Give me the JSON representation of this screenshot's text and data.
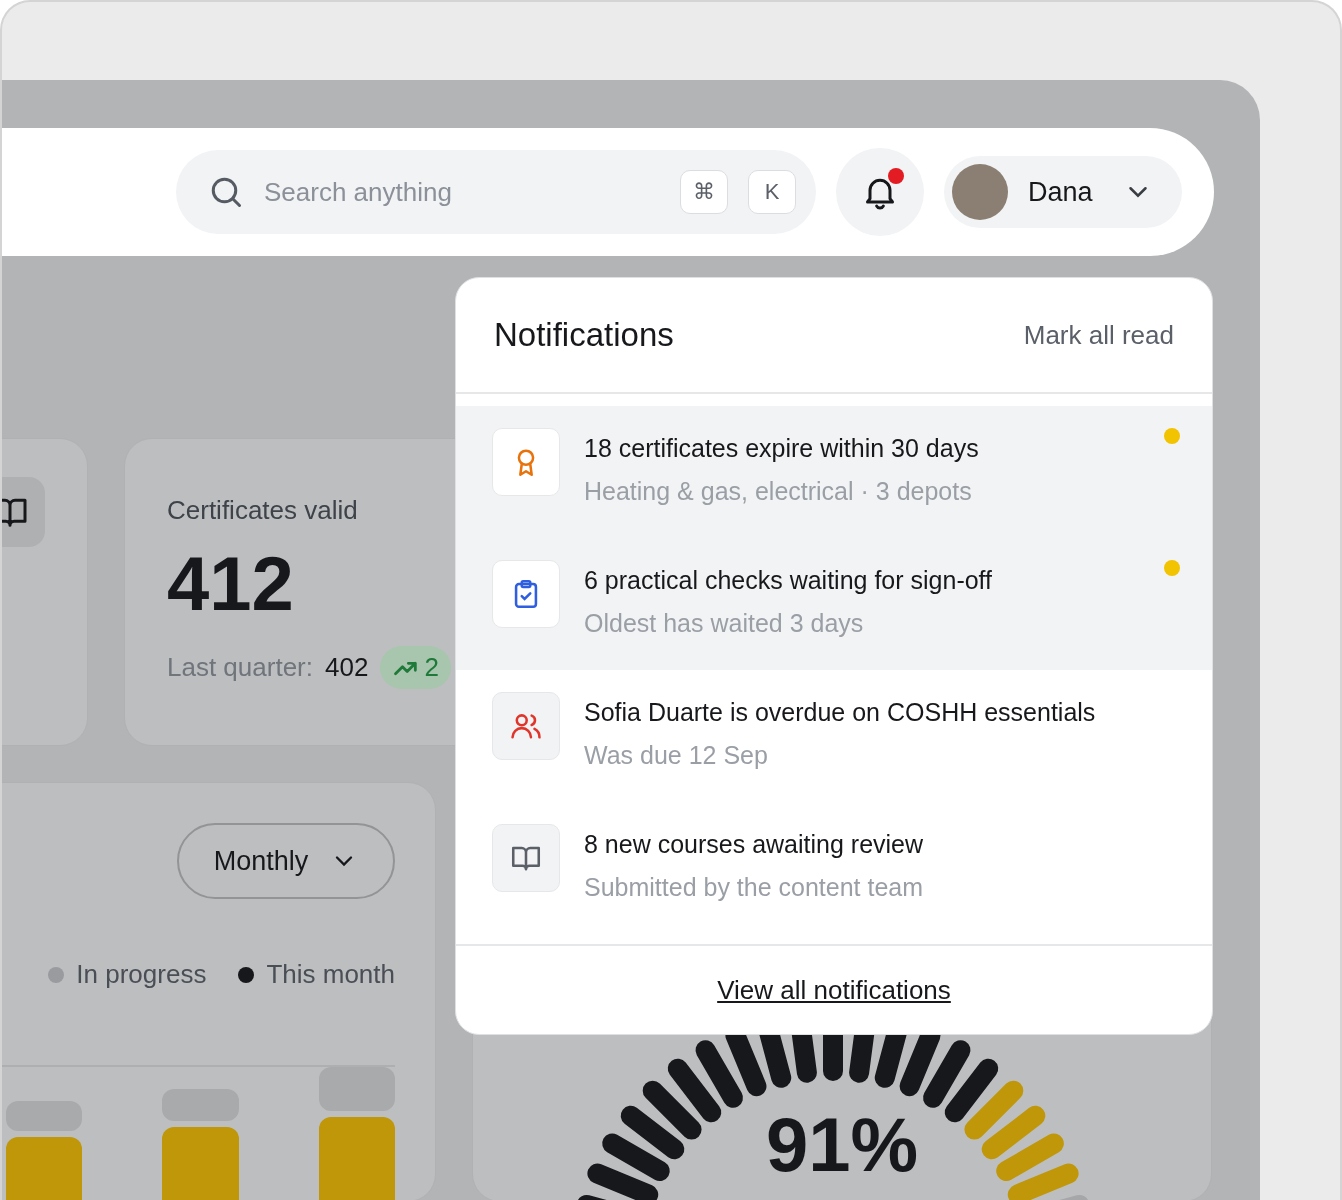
{
  "search": {
    "placeholder": "Search anything",
    "keys": [
      "⌘",
      "K"
    ]
  },
  "notifications_button": {
    "unread": true
  },
  "user": {
    "name": "Dana"
  },
  "stat_card": {
    "label": "Certificates valid",
    "value": "412",
    "comparison_label": "Last quarter:",
    "comparison_value": "402",
    "trend": "2"
  },
  "chart_card": {
    "period": "Monthly",
    "legend": [
      {
        "label": "In progress",
        "color": "#9a9b9e"
      },
      {
        "label": "This month",
        "color": "#17181b"
      }
    ]
  },
  "gauge": {
    "value": "91%"
  },
  "notifications_panel": {
    "title": "Notifications",
    "mark_all": "Mark all read",
    "footer_link": "View all notifications",
    "items": [
      {
        "kind": "award",
        "title": "18 certificates expire within 30 days",
        "subtitle": "Heating & gas, electrical · 3 depots",
        "unread": true
      },
      {
        "kind": "clipboard",
        "title": "6 practical checks waiting for sign-off",
        "subtitle": "Oldest has waited 3 days",
        "unread": true
      },
      {
        "kind": "users",
        "title": "Sofia Duarte is overdue on COSHH essentials",
        "subtitle": "Was due 12 Sep",
        "unread": false
      },
      {
        "kind": "book",
        "title": "8 new courses awaiting review",
        "subtitle": "Submitted by the content team",
        "unread": false
      }
    ]
  }
}
